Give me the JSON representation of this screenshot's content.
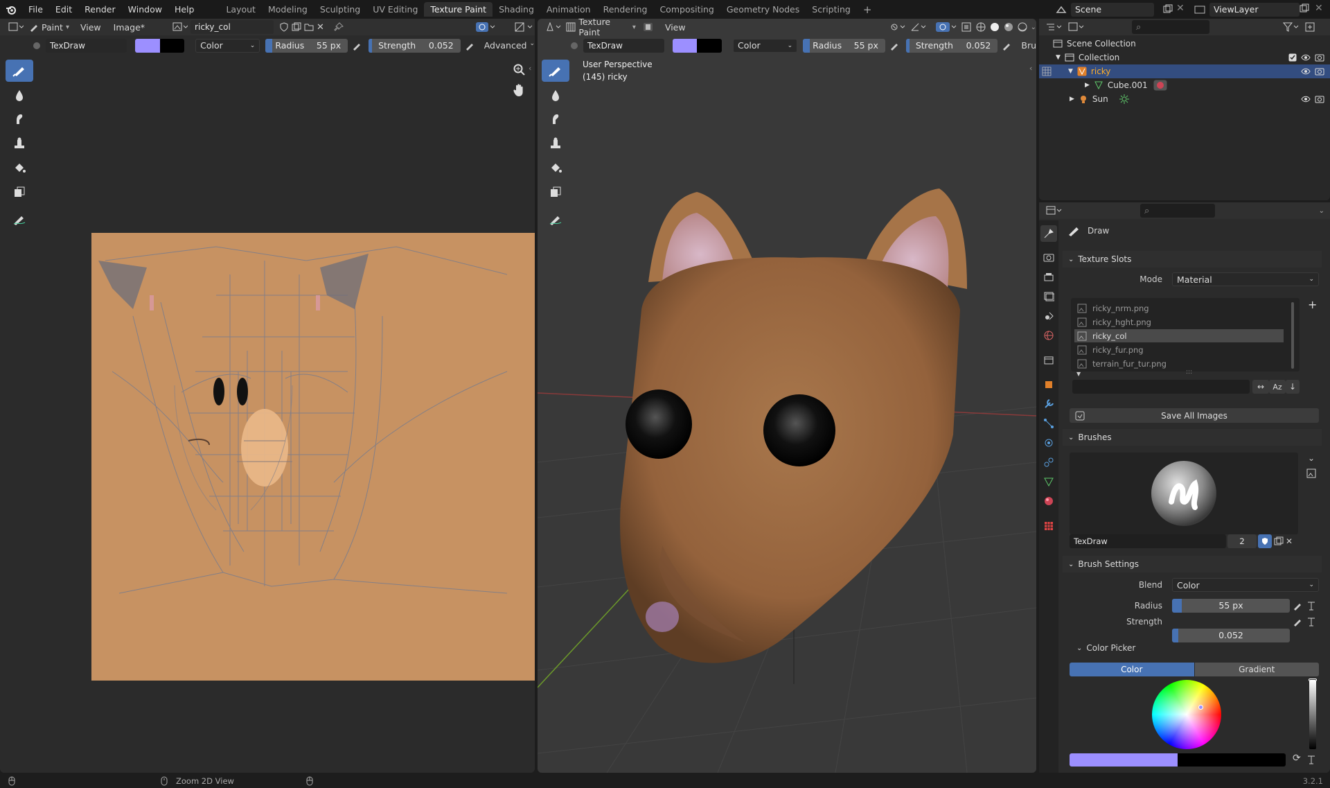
{
  "topmenu": {
    "items": [
      "File",
      "Edit",
      "Render",
      "Window",
      "Help"
    ],
    "workspaces": [
      "Layout",
      "Modeling",
      "Sculpting",
      "UV Editing",
      "Texture Paint",
      "Shading",
      "Animation",
      "Rendering",
      "Compositing",
      "Geometry Nodes",
      "Scripting"
    ],
    "active_workspace": "Texture Paint",
    "add_label": "+",
    "scene": "Scene",
    "view_layer": "ViewLayer"
  },
  "image_editor": {
    "mode": "Paint",
    "view_menu": "View",
    "image_menu": "Image*",
    "image_name": "ricky_col",
    "brush": "TexDraw",
    "blend": "Color",
    "radius_label": "Radius",
    "radius_value": "55 px",
    "strength_label": "Strength",
    "strength_value": "0.052",
    "advanced": "Advanced"
  },
  "viewport": {
    "mode": "Texture Paint",
    "view_menu": "View",
    "brush": "TexDraw",
    "blend": "Color",
    "radius_label": "Radius",
    "radius_value": "55 px",
    "strength_label": "Strength",
    "strength_value": "0.052",
    "brush_trunc": "Bru",
    "overlay_title": "User Perspective",
    "overlay_sub": "(145) ricky"
  },
  "outliner": {
    "scene_collection": "Scene Collection",
    "collection": "Collection",
    "obj_ricky": "ricky",
    "obj_cube": "Cube.001",
    "obj_sun": "Sun"
  },
  "properties": {
    "tool_name": "Draw",
    "texture_slots_header": "Texture Slots",
    "mode_label": "Mode",
    "mode_value": "Material",
    "slots": [
      "ricky_nrm.png",
      "ricky_hght.png",
      "ricky_col",
      "ricky_fur.png",
      "terrain_fur_tur.png"
    ],
    "selected_slot": 2,
    "save_all": "Save All Images",
    "brushes_header": "Brushes",
    "brush_name": "TexDraw",
    "brush_users": "2",
    "brush_settings_header": "Brush Settings",
    "blend_label": "Blend",
    "blend_value": "Color",
    "radius_label": "Radius",
    "radius_value": "55 px",
    "strength_label": "Strength",
    "strength_value": "0.052",
    "color_picker_header": "Color Picker",
    "tab_color": "Color",
    "tab_gradient": "Gradient",
    "sort_label": "Az"
  },
  "statusbar": {
    "hint": "Zoom 2D View",
    "version": "3.2.1"
  },
  "colors": {
    "accent": "#4772b3",
    "paint_color": "#9c8fff",
    "secondary_color": "#000000",
    "texture_base": "#c79262",
    "fur": "#9b6a44"
  },
  "brush_strength_fraction": 0.052
}
